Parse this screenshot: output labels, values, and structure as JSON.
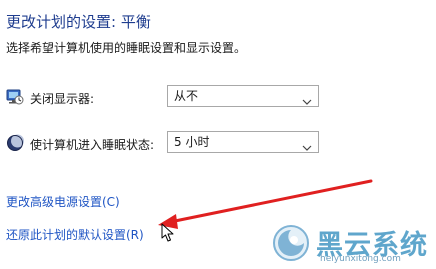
{
  "header": {
    "title": "更改计划的设置: 平衡",
    "subtitle": "选择希望计算机使用的睡眠设置和显示设置。"
  },
  "settings": {
    "display_off": {
      "label": "关闭显示器:",
      "value": "从不",
      "icon": "monitor-icon"
    },
    "sleep": {
      "label": "使计算机进入睡眠状态:",
      "value": "5 小时",
      "icon": "moon-icon"
    }
  },
  "links": {
    "advanced": "更改高级电源设置(C)",
    "restore": "还原此计划的默认设置(R)"
  },
  "overlay": {
    "arrow_color": "#e02020",
    "cursor_icon": "mouse-pointer-icon"
  },
  "watermark": {
    "name": "黑云系统",
    "url": "heiyunxitong.com",
    "color": "#5fa6cc"
  }
}
